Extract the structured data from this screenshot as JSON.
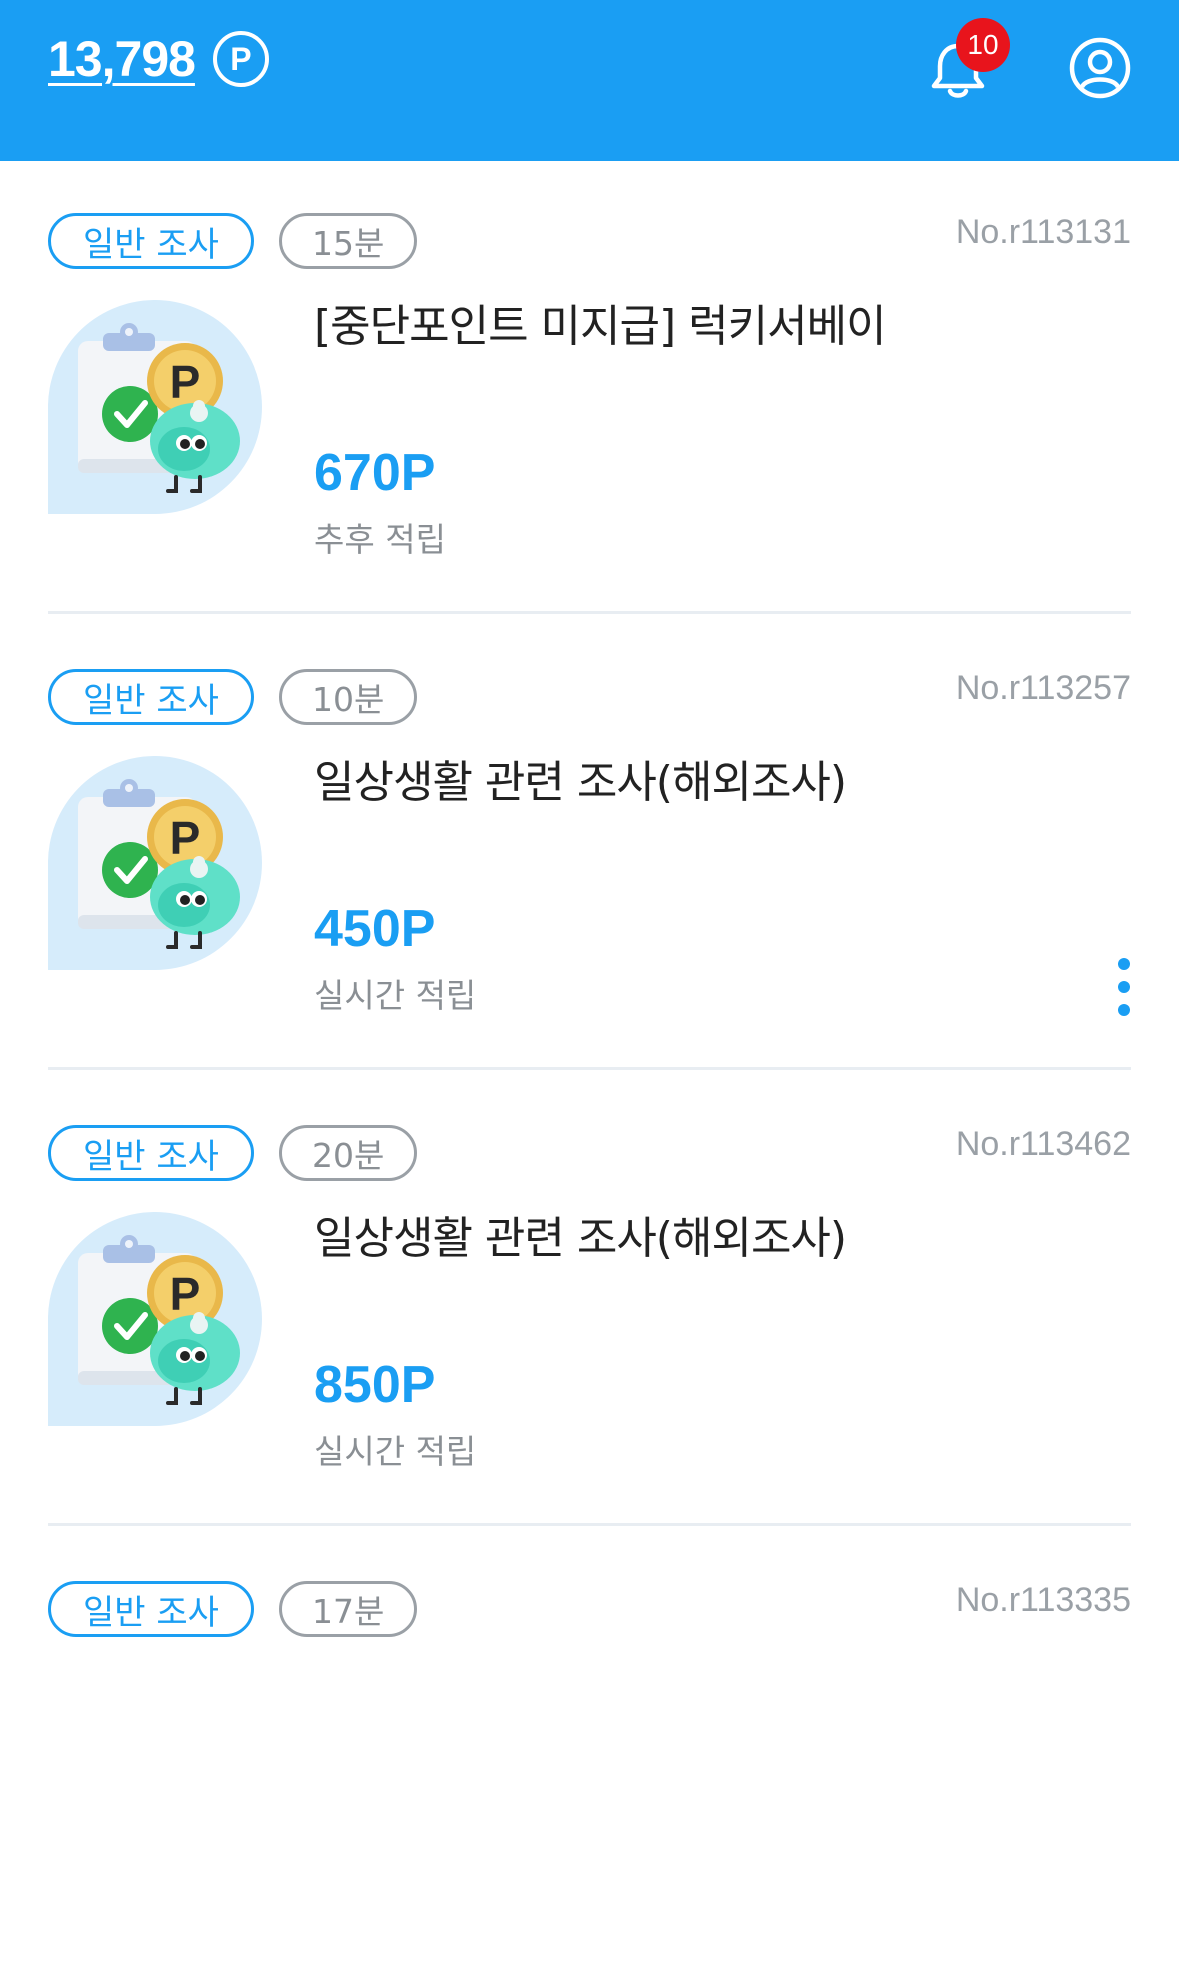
{
  "header": {
    "points": "13,798",
    "points_unit": "P",
    "notification_count": "10",
    "colors": {
      "brand": "#1a9ef3",
      "badge": "#e8141c"
    }
  },
  "surveys": [
    {
      "type": "일반 조사",
      "duration": "15분",
      "number": "No.r113131",
      "title": "[중단포인트 미지급] 럭키서베이",
      "reward": "670P",
      "pay_timing": "추후 적립"
    },
    {
      "type": "일반 조사",
      "duration": "10분",
      "number": "No.r113257",
      "title": "일상생활 관련 조사(해외조사)",
      "reward": "450P",
      "pay_timing": "실시간 적립"
    },
    {
      "type": "일반 조사",
      "duration": "20분",
      "number": "No.r113462",
      "title": "일상생활 관련 조사(해외조사)",
      "reward": "850P",
      "pay_timing": "실시간 적립"
    },
    {
      "type": "일반 조사",
      "duration": "17분",
      "number": "No.r113335"
    }
  ]
}
